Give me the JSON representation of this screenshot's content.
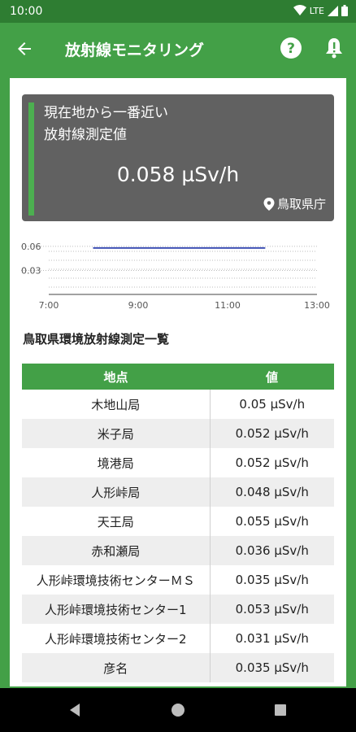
{
  "status_bar": {
    "time": "10:00",
    "network": "LTE"
  },
  "app_bar": {
    "title": "放射線モニタリング"
  },
  "card": {
    "label_line1": "現在地から一番近い",
    "label_line2": "放射線測定値",
    "value": "0.058 µSv/h",
    "place": "鳥取県庁"
  },
  "chart_data": {
    "type": "line",
    "y_ticks": [
      "0.06",
      "0.03"
    ],
    "x_ticks": [
      "7:00",
      "9:00",
      "11:00",
      "13:00"
    ],
    "xlim": [
      "7:00",
      "13:00"
    ],
    "ylim": [
      0,
      0.065
    ],
    "series": [
      {
        "x": [
          "8:00",
          "8:30",
          "9:00",
          "9:30",
          "10:00",
          "10:30",
          "11:00",
          "11:30",
          "11:50"
        ],
        "values": [
          0.058,
          0.058,
          0.058,
          0.058,
          0.058,
          0.058,
          0.058,
          0.058,
          0.058
        ]
      }
    ],
    "colors": {
      "line": "#3f51b5"
    }
  },
  "list": {
    "title": "鳥取県環境放射線測定一覧",
    "headers": {
      "location": "地点",
      "value": "値"
    },
    "rows": [
      {
        "location": "木地山局",
        "value": "0.05 µSv/h"
      },
      {
        "location": "米子局",
        "value": "0.052 µSv/h"
      },
      {
        "location": "境港局",
        "value": "0.052 µSv/h"
      },
      {
        "location": "人形峠局",
        "value": "0.048 µSv/h"
      },
      {
        "location": "天王局",
        "value": "0.055 µSv/h"
      },
      {
        "location": "赤和瀬局",
        "value": "0.036 µSv/h"
      },
      {
        "location": "人形峠環境技術センターＭＳ",
        "value": "0.035 µSv/h"
      },
      {
        "location": "人形峠環境技術センター1",
        "value": "0.053 µSv/h"
      },
      {
        "location": "人形峠環境技術センター2",
        "value": "0.031 µSv/h"
      },
      {
        "location": "彦名",
        "value": "0.035 µSv/h"
      }
    ]
  },
  "colors": {
    "primary": "#43a047",
    "status": "#2e7d32",
    "card": "#616161"
  },
  "icons": {
    "back": "arrow-left-icon",
    "help": "help-circle-icon",
    "alert": "warning-icon",
    "place": "location-pin-icon"
  }
}
